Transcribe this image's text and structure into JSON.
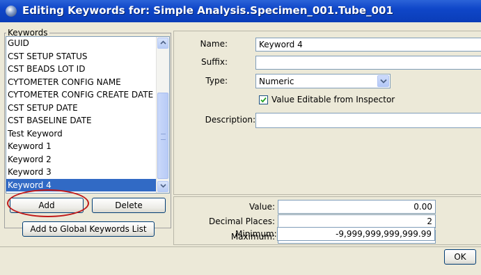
{
  "window": {
    "title": "Editing Keywords for: Simple Analysis.Specimen_001.Tube_001"
  },
  "keywords": {
    "legend": "Keywords",
    "items": [
      "GUID",
      "CST SETUP STATUS",
      "CST BEADS LOT ID",
      "CYTOMETER CONFIG NAME",
      "CYTOMETER CONFIG CREATE DATE",
      "CST SETUP DATE",
      "CST BASELINE DATE",
      "Test Keyword",
      "Keyword 1",
      "Keyword 2",
      "Keyword 3",
      "Keyword 4"
    ],
    "selected": "Keyword 4",
    "add_label": "Add",
    "delete_label": "Delete",
    "add_global_label": "Add to Global Keywords List"
  },
  "form": {
    "name_label": "Name:",
    "name_value": "Keyword 4",
    "suffix_label": "Suffix:",
    "suffix_value": "",
    "type_label": "Type:",
    "type_value": "Numeric",
    "editable_label": "Value Editable from Inspector",
    "editable_checked": true,
    "description_label": "Description:",
    "description_value": ""
  },
  "values": {
    "value_label": "Value:",
    "value": "0.00",
    "decimal_label": "Decimal Places:",
    "decimal": "2",
    "max_label": "Maximum:",
    "max": "9,999,999,999,999.99",
    "min_label": "Minimum:",
    "min": "-9,999,999,999,999.99"
  },
  "footer": {
    "ok_label": "OK"
  },
  "colors": {
    "titlebar": "#0f46c8",
    "selection": "#316ac5",
    "highlight_oval": "#c01818"
  }
}
